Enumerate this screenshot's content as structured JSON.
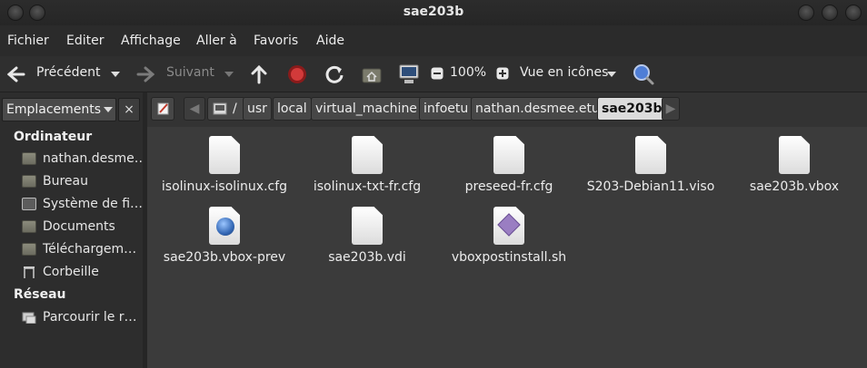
{
  "window": {
    "title": "sae203b"
  },
  "menu": [
    "Fichier",
    "Editer",
    "Affichage",
    "Aller à",
    "Favoris",
    "Aide"
  ],
  "toolbar": {
    "back_label": "Précédent",
    "forward_label": "Suivant",
    "zoom": "100%",
    "view_label": "Vue en icônes"
  },
  "sidebar": {
    "header": "Emplacements",
    "close": "×",
    "sections": [
      {
        "title": "Ordinateur"
      },
      {
        "title": "Réseau"
      }
    ],
    "computer_items": [
      {
        "label": "nathan.desme…",
        "icon": "home-folder-icon"
      },
      {
        "label": "Bureau",
        "icon": "desktop-folder-icon"
      },
      {
        "label": "Système de fi…",
        "icon": "filesystem-icon"
      },
      {
        "label": "Documents",
        "icon": "documents-folder-icon"
      },
      {
        "label": "Téléchargem…",
        "icon": "downloads-folder-icon"
      },
      {
        "label": "Corbeille",
        "icon": "trash-icon"
      }
    ],
    "network_items": [
      {
        "label": "Parcourir le r…",
        "icon": "network-icon"
      }
    ]
  },
  "path": {
    "segments": [
      "/",
      "usr",
      "local",
      "virtual_machine",
      "infoetu",
      "nathan.desmee.etu",
      "sae203b"
    ]
  },
  "files": [
    {
      "name": "isolinux-isolinux.cfg",
      "icon": "text-file-icon"
    },
    {
      "name": "isolinux-txt-fr.cfg",
      "icon": "text-file-icon"
    },
    {
      "name": "preseed-fr.cfg",
      "icon": "text-file-icon"
    },
    {
      "name": "S203-Debian11.viso",
      "icon": "text-file-icon"
    },
    {
      "name": "sae203b.vbox",
      "icon": "text-file-icon"
    },
    {
      "name": "sae203b.vbox-prev",
      "icon": "web-file-icon"
    },
    {
      "name": "sae203b.vdi",
      "icon": "text-file-icon"
    },
    {
      "name": "vboxpostinstall.sh",
      "icon": "script-file-icon"
    }
  ]
}
